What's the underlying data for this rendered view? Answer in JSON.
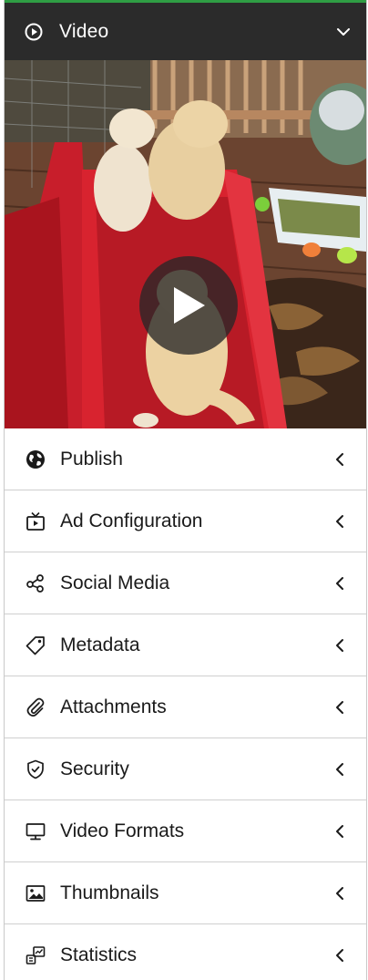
{
  "header": {
    "title": "Video",
    "accent_color": "#2f9e44",
    "background": "#2b2b2b"
  },
  "player": {
    "icon": "play-icon",
    "thumbnail_description_visible": true
  },
  "menu": {
    "items": [
      {
        "label": "Publish",
        "icon": "globe-icon"
      },
      {
        "label": "Ad Configuration",
        "icon": "tv-icon"
      },
      {
        "label": "Social Media",
        "icon": "share-icon"
      },
      {
        "label": "Metadata",
        "icon": "tag-icon"
      },
      {
        "label": "Attachments",
        "icon": "paperclip-icon"
      },
      {
        "label": "Security",
        "icon": "shield-icon"
      },
      {
        "label": "Video Formats",
        "icon": "monitor-icon"
      },
      {
        "label": "Thumbnails",
        "icon": "image-icon"
      },
      {
        "label": "Statistics",
        "icon": "stats-icon"
      }
    ]
  }
}
